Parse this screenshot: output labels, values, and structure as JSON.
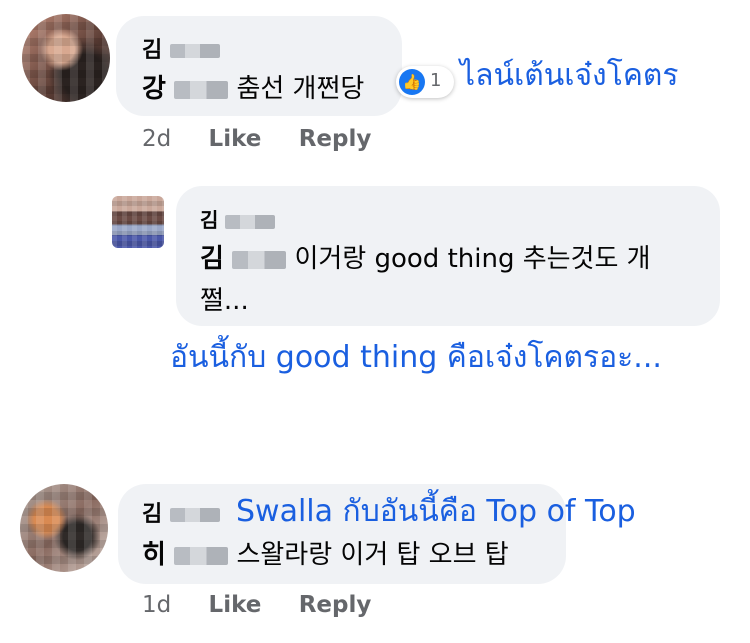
{
  "colors": {
    "bubble_bg": "#f0f2f5",
    "meta_text": "#65676b",
    "like_blue": "#1877f2",
    "annotation": "#1a5fe0"
  },
  "comments": [
    {
      "author_initial": "김",
      "text_prefix": "강",
      "text": "춤선 개쩐당",
      "reaction_count": "1",
      "time": "2d",
      "like_label": "Like",
      "reply_label": "Reply",
      "annotation": "ไลน์เต้นเจ๋งโคตร"
    },
    {
      "author_initial": "김",
      "text_prefix": "김",
      "text_line1": "이거랑 good thing 추는것도 개",
      "text_line2": "쩔...",
      "annotation": "อันนี้กับ good thing คือเจ๋งโคตรอะ..."
    },
    {
      "author_initial": "김",
      "text_prefix": "히",
      "text": "스왈라랑 이거 탑 오브 탑",
      "time": "1d",
      "like_label": "Like",
      "reply_label": "Reply",
      "annotation": "Swalla กับอันนี้คือ Top of Top"
    }
  ]
}
